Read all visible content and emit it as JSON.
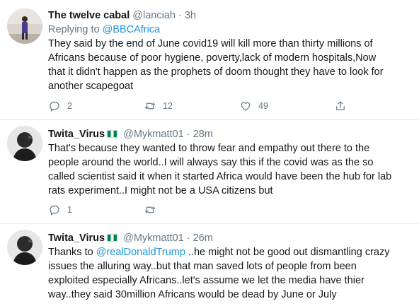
{
  "tweets": [
    {
      "name": "The twelve cabal",
      "handle": "@lanciah",
      "dot": "·",
      "time": "3h",
      "reply_prefix": "Replying to ",
      "reply_to": "@BBCAfrica",
      "lines": [
        "They said by the end of June covid19 will kill more than thirty millions of",
        "Africans  because of poor hygiene, poverty,lack of modern hospitals,Now",
        "that it didn't happen as the prophets of doom thought they have to look for",
        "another scapegoat"
      ],
      "replies": "2",
      "retweets": "12",
      "likes": "49"
    },
    {
      "name": "Twita_Virus",
      "flag": "nigeria-flag",
      "handle": "@Mykmatt01",
      "dot": "·",
      "time": "28m",
      "lines": [
        "That's because they wanted to throw fear and empathy  out there to the",
        "people around the world..I will always say this if the covid was as the so",
        "called scientist said it when it started Africa would have been the hub for lab",
        "rats experiment..I might not be a USA citizens but"
      ],
      "replies": "1"
    },
    {
      "name": "Twita_Virus",
      "flag": "nigeria-flag",
      "handle": "@Mykmatt01",
      "dot": "·",
      "time": "26m",
      "line1_prefix": "Thanks to ",
      "line1_mention": "@realDonaldTrump",
      "line1_suffix": " ..he might not be good out dismantling crazy",
      "lines": [
        "issues the alluring way..but that man saved lots of people from been",
        "exploited especially Africans..let's assume we let the media have thier",
        "way..they said 30million Africans would be dead by June or July"
      ]
    }
  ],
  "icons": [
    "reply-icon",
    "retweet-icon",
    "like-icon",
    "share-icon"
  ],
  "colors": {
    "link": "#1b95e0",
    "muted": "#657786",
    "divider": "#e6ecf0"
  }
}
